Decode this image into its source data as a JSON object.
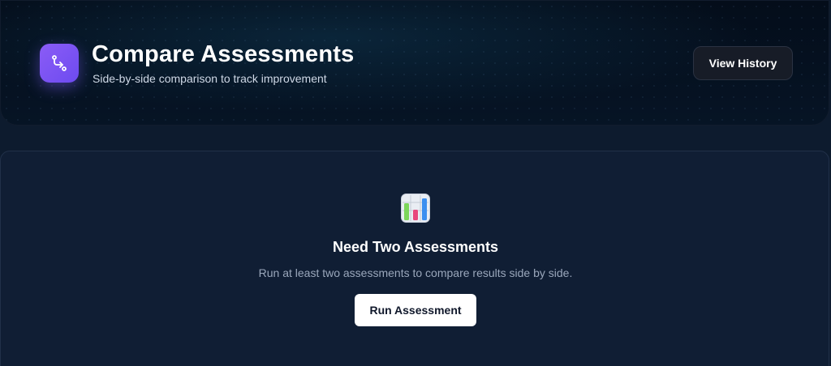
{
  "header": {
    "icon": "compare-arrows-icon",
    "title": "Compare Assessments",
    "subtitle": "Side-by-side comparison to track improvement",
    "history_button_label": "View History",
    "accent_color": "#7c5cf6"
  },
  "empty_state": {
    "icon": "bar-chart-icon",
    "title": "Need Two Assessments",
    "message": "Run at least two assessments to compare results side by side.",
    "button_label": "Run Assessment"
  }
}
